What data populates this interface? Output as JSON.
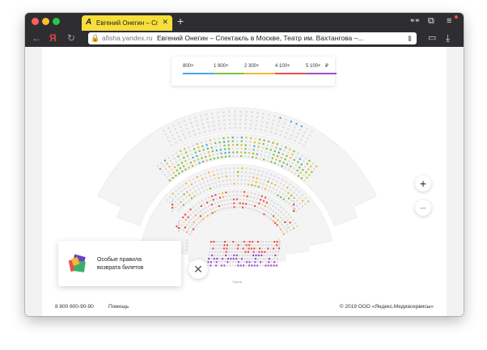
{
  "browser": {
    "tab_title": "Евгений Онегин – Спе",
    "new_tab": "+",
    "url_domain": "afisha.yandex.ru",
    "page_title": "Евгений Онегин – Спектакль в Москве, Театр им. Вахтангова –..."
  },
  "price_legend": {
    "items": [
      {
        "label": "800+",
        "color": "#4aa6e8"
      },
      {
        "label": "1 900+",
        "color": "#7dc446"
      },
      {
        "label": "2 300+",
        "color": "#f2b83a"
      },
      {
        "label": "4 100+",
        "color": "#e8504f"
      },
      {
        "label": "5 100+",
        "color": "#a04fc9"
      }
    ],
    "currency": "₽"
  },
  "zoom": {
    "in": "+",
    "out": "−"
  },
  "refund": {
    "line1": "Особые правила",
    "line2": "возврата билетов"
  },
  "close": "✕",
  "stage_label": "Сцена",
  "footer": {
    "phone": "8 800 600-90-90",
    "help": "Помощь",
    "copyright": "© 2019 ООО «Яндекс.Медиасервисы»"
  }
}
